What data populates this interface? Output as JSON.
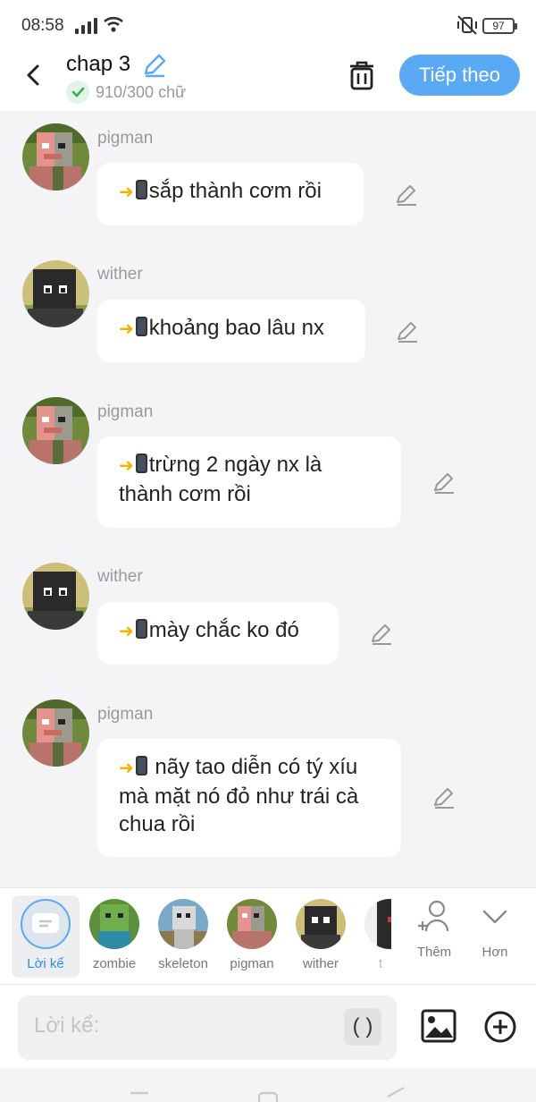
{
  "status_bar": {
    "time": "08:58",
    "battery": "97"
  },
  "header": {
    "title": "chap 3",
    "word_count": "910/300 chữ",
    "next_label": "Tiếp theo"
  },
  "messages": [
    {
      "speaker": "pigman",
      "text": "sắp thành cơm rồi"
    },
    {
      "speaker": "wither",
      "text": "khoảng bao lâu nx"
    },
    {
      "speaker": "pigman",
      "text": "trừng 2 ngày nx là thành cơm rồi"
    },
    {
      "speaker": "wither",
      "text": "mày chắc ko đó"
    },
    {
      "speaker": "pigman",
      "text": " nãy tao diễn có tý xíu mà mặt nó đỏ như trái cà chua rồi"
    }
  ],
  "characters": [
    {
      "label": "Lời kể",
      "icon": "narration-icon"
    },
    {
      "label": "zombie"
    },
    {
      "label": "skeleton"
    },
    {
      "label": "pigman"
    },
    {
      "label": "wither"
    },
    {
      "label": "t"
    }
  ],
  "controls": {
    "add_label": "Thêm",
    "more_label": "Hơn"
  },
  "input": {
    "placeholder": "Lời kể:",
    "paren_label": "( )"
  },
  "colors": {
    "accent": "#5aa9f5",
    "bubble": "#ffffff",
    "background": "#f4f4f6"
  }
}
